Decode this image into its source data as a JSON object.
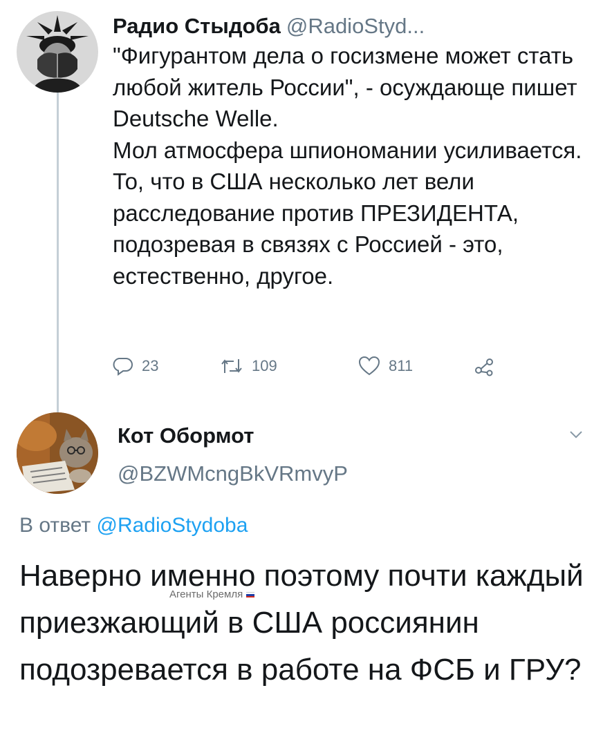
{
  "tweet1": {
    "display_name": "Радио Стыдоба",
    "handle": "@RadioStyd...",
    "paragraphs": [
      "\"Фигурантом дела о госизмене может стать любой житель России\", - осуждающе пишет Deutsche Welle.",
      "Мол атмосфера шпиономании усиливается.",
      "То, что в США несколько лет вели расследование против ПРЕЗИДЕНТА, подозревая в связях с Россией - это, естественно, другое."
    ],
    "actions": {
      "reply_count": "23",
      "retweet_count": "109",
      "like_count": "811",
      "icons": [
        "reply-icon",
        "retweet-icon",
        "like-icon",
        "share-icon"
      ]
    }
  },
  "tweet2": {
    "display_name": "Кот Обормот",
    "handle": "@BZWMcngBkVRmvyP",
    "reply_prefix": "В ответ",
    "reply_to_handle": "@RadioStydoba",
    "text": "Наверно именно поэтому почти каждый приезжающий в США россиянин подозревается в работе на ФСБ и ГРУ?"
  },
  "watermark": {
    "text": "Агенты Кремля",
    "flag_colors": [
      "#ffffff",
      "#1f3fa8",
      "#d52b1e"
    ]
  },
  "colors": {
    "text": "#14171a",
    "secondary": "#657786",
    "link": "#1da1f2",
    "thread_line": "#c4cfd6"
  }
}
